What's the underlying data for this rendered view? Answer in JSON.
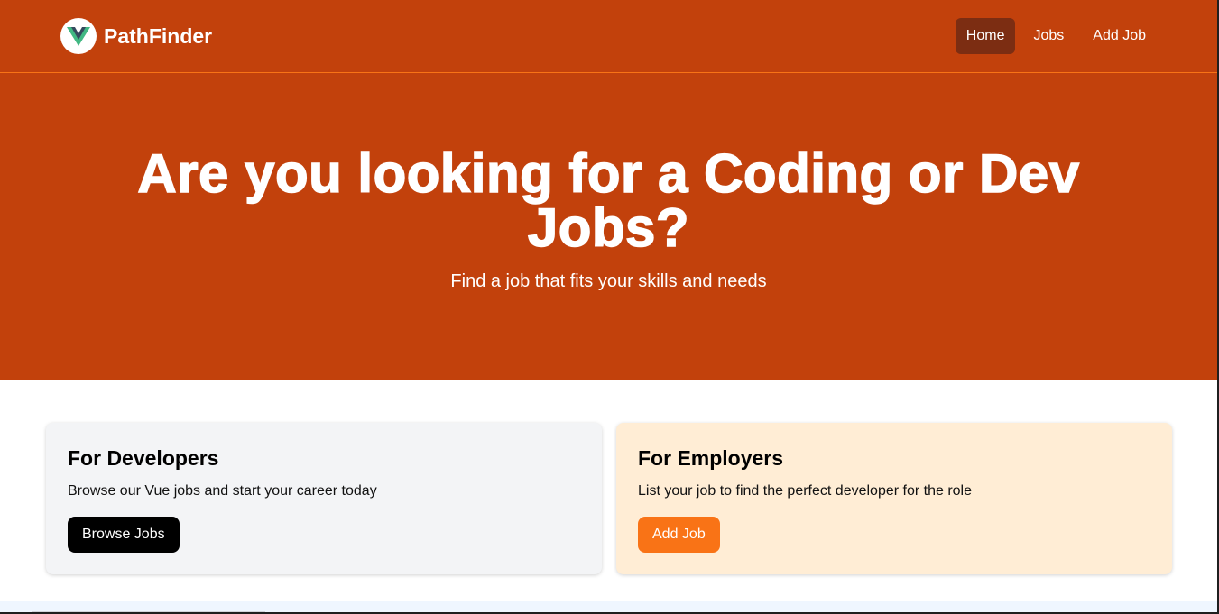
{
  "brand": {
    "name": "PathFinder",
    "logo_icon": "vue-logo-icon"
  },
  "nav": {
    "items": [
      {
        "label": "Home",
        "active": true
      },
      {
        "label": "Jobs",
        "active": false
      },
      {
        "label": "Add Job",
        "active": false
      }
    ]
  },
  "hero": {
    "title": "Are you looking for a Coding or Dev Jobs?",
    "subtitle": "Find a job that fits your skills and needs"
  },
  "cards": {
    "developers": {
      "title": "For Developers",
      "text": "Browse our Vue jobs and start your career today",
      "button": "Browse Jobs"
    },
    "employers": {
      "title": "For Employers",
      "text": "List your job to find the perfect developer for the role",
      "button": "Add Job"
    }
  },
  "colors": {
    "primary": "#c2410c",
    "active_nav": "#7c2d12",
    "accent": "#f97316",
    "dev_card_bg": "#f3f4f6",
    "employer_card_bg": "#ffedd5"
  }
}
